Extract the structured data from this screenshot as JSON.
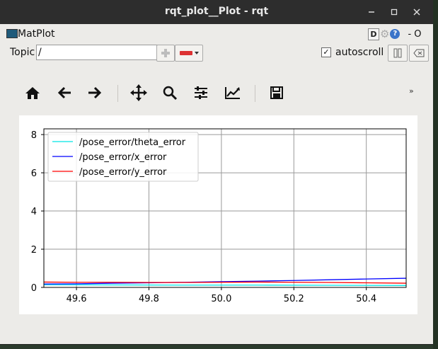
{
  "window": {
    "title": "rqt_plot__Plot - rqt"
  },
  "menubar": {
    "app_name": "MatPlot",
    "d_label": "D",
    "close_label": "- O"
  },
  "topic": {
    "label": "Topic",
    "value": "/"
  },
  "autoscroll": {
    "label": "autoscroll",
    "checked": true
  },
  "toolbar": {
    "icons": [
      "home-icon",
      "back-icon",
      "forward-icon",
      "pan-icon",
      "zoom-icon",
      "subplots-icon",
      "edit-curves-icon",
      "save-icon"
    ],
    "more_label": "»"
  },
  "chart_data": {
    "type": "line",
    "title": "",
    "xlabel": "",
    "ylabel": "",
    "xlim": [
      49.51,
      50.51
    ],
    "ylim": [
      0,
      8.3
    ],
    "xticks": [
      "49.6",
      "49.8",
      "50.0",
      "50.2",
      "50.4"
    ],
    "yticks": [
      "0",
      "2",
      "4",
      "6",
      "8"
    ],
    "grid": true,
    "legend_position": "upper-left",
    "series": [
      {
        "name": "/pose_error/theta_error",
        "color": "#00e5e5",
        "x": [
          49.51,
          49.7,
          49.9,
          50.1,
          50.3,
          50.51
        ],
        "y": [
          0.14,
          0.13,
          0.12,
          0.12,
          0.11,
          0.1
        ]
      },
      {
        "name": "/pose_error/x_error",
        "color": "#0000ff",
        "x": [
          49.51,
          49.6,
          49.7,
          49.8,
          49.9,
          50.0,
          50.1,
          50.2,
          50.3,
          50.4,
          50.51
        ],
        "y": [
          0.18,
          0.19,
          0.22,
          0.24,
          0.27,
          0.3,
          0.33,
          0.36,
          0.4,
          0.44,
          0.48
        ]
      },
      {
        "name": "/pose_error/y_error",
        "color": "#ff0000",
        "x": [
          49.51,
          49.6,
          49.7,
          49.8,
          49.9,
          50.0,
          50.1,
          50.2,
          50.3,
          50.4,
          50.51
        ],
        "y": [
          0.28,
          0.27,
          0.27,
          0.26,
          0.26,
          0.27,
          0.28,
          0.27,
          0.26,
          0.24,
          0.22
        ]
      }
    ]
  }
}
